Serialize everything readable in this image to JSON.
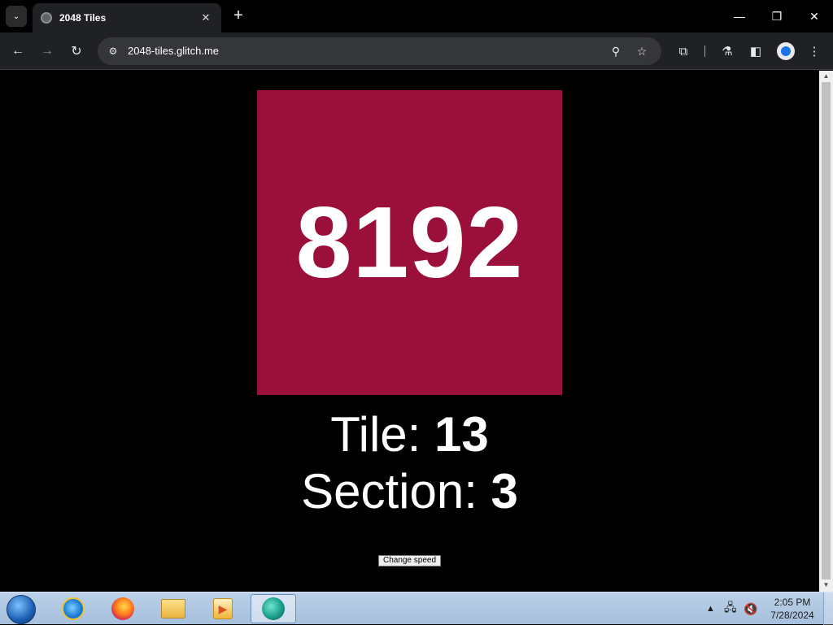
{
  "browser": {
    "tab_title": "2048 Tiles",
    "url": "2048-tiles.glitch.me"
  },
  "tile": {
    "value": "8192",
    "color": "#9b103b"
  },
  "info": {
    "tile_label": "Tile: ",
    "tile_number": "13",
    "section_label": "Section: ",
    "section_number": "3"
  },
  "button": {
    "change_speed": "Change speed"
  },
  "taskbar": {
    "time": "2:05 PM",
    "date": "7/28/2024",
    "apps": [
      "internet-explorer",
      "firefox",
      "file-explorer",
      "media-player",
      "browser-active"
    ]
  }
}
